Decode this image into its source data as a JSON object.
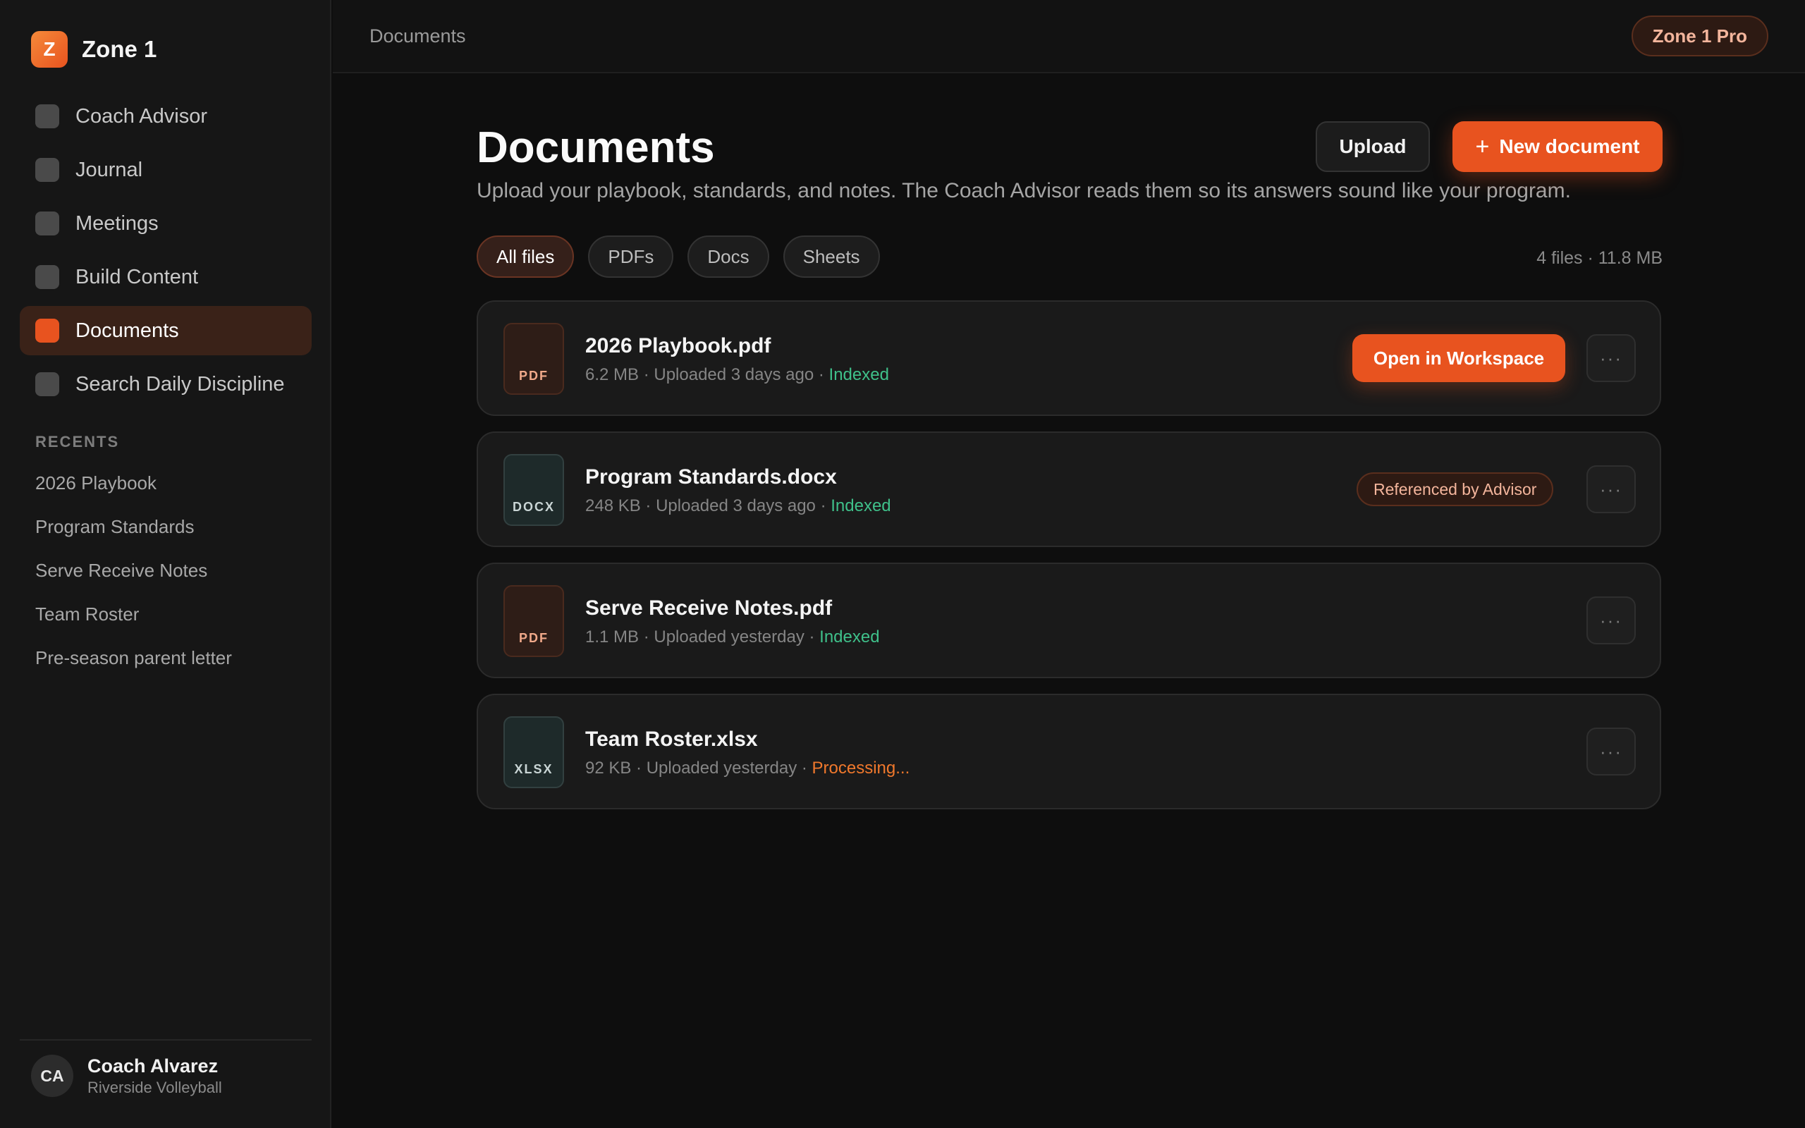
{
  "brand": {
    "logo_letter": "Z",
    "name": "Zone 1"
  },
  "nav": {
    "items": [
      {
        "label": "Coach Advisor",
        "active": false
      },
      {
        "label": "Journal",
        "active": false
      },
      {
        "label": "Meetings",
        "active": false
      },
      {
        "label": "Build Content",
        "active": false
      },
      {
        "label": "Documents",
        "active": true
      },
      {
        "label": "Search Daily Discipline",
        "active": false
      }
    ]
  },
  "recents": {
    "title": "RECENTS",
    "items": [
      "2026 Playbook",
      "Program Standards",
      "Serve Receive Notes",
      "Team Roster",
      "Pre-season parent letter"
    ]
  },
  "user": {
    "initials": "CA",
    "name": "Coach Alvarez",
    "org": "Riverside Volleyball"
  },
  "topbar": {
    "breadcrumb": "Documents",
    "plan": "Zone 1 Pro"
  },
  "page": {
    "title": "Documents",
    "subtitle": "Upload your playbook, standards, and notes. The Coach Advisor reads them so its answers sound like your program.",
    "upload_label": "Upload",
    "new_label": "New document",
    "new_icon": "+"
  },
  "filters": {
    "chips": [
      "All files",
      "PDFs",
      "Docs",
      "Sheets"
    ],
    "active": "All files",
    "summary": "4 files · 11.8 MB"
  },
  "files": [
    {
      "type": "PDF",
      "name": "2026 Playbook.pdf",
      "size": "6.2 MB",
      "uploaded": "Uploaded 3 days ago",
      "status": "Indexed",
      "action": "Open in Workspace",
      "more": "···"
    },
    {
      "type": "DOCX",
      "name": "Program Standards.docx",
      "size": "248 KB",
      "uploaded": "Uploaded 3 days ago",
      "status": "Indexed",
      "badge": "Referenced by Advisor",
      "more": "···"
    },
    {
      "type": "PDF",
      "name": "Serve Receive Notes.pdf",
      "size": "1.1 MB",
      "uploaded": "Uploaded yesterday",
      "status": "Indexed",
      "more": "···"
    },
    {
      "type": "XLSX",
      "name": "Team Roster.xlsx",
      "size": "92 KB",
      "uploaded": "Uploaded yesterday",
      "status": "Processing...",
      "more": "···"
    }
  ],
  "meta_separator": " · ",
  "colors": {
    "accent": "#e8531f",
    "indexed": "#3fc08a",
    "processing": "#f0782c"
  }
}
